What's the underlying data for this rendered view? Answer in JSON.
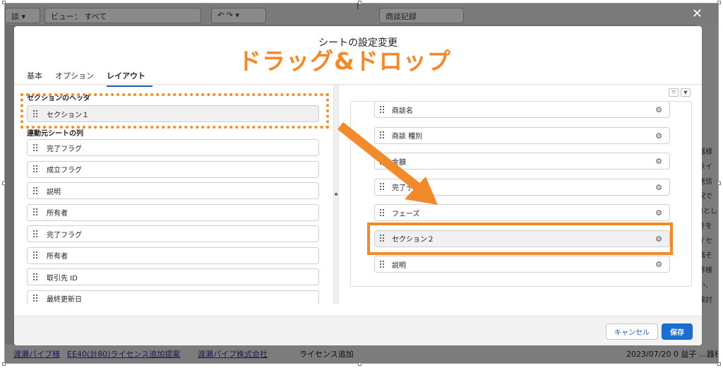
{
  "background": {
    "top_left_label": "談",
    "view_label": "ビュー： すべて",
    "filter_pill": "商談記録",
    "right_column": [
      "器様",
      "ライ",
      "送信",
      "況で",
      "Bとし",
      "きを",
      "イセ",
      "務そ",
      "界様",
      "い、",
      "検討"
    ],
    "bottom_row": {
      "link1": "渡瀬パイプ様",
      "link2": "EE40(計80)ライセンス追加提案",
      "link3": "渡瀬パイプ株式会社",
      "text4": "ライセンス追加",
      "text5": "2023/07/20 0 益子 …器様"
    },
    "close_glyph": "✕"
  },
  "modal": {
    "title": "シートの設定変更",
    "tabs": [
      {
        "label": "基本",
        "active": false
      },
      {
        "label": "オプション",
        "active": false
      },
      {
        "label": "レイアウト",
        "active": true
      }
    ],
    "left": {
      "section_header_label": "セクションのヘッダ",
      "section_header_item": "セクション１",
      "source_columns_label": "連動元シートの列",
      "fields": [
        "完了フラグ",
        "成立フラグ",
        "説明",
        "所有者",
        "完了フラグ",
        "所有者",
        "取引先 ID",
        "最終更新日"
      ]
    },
    "right": {
      "fields": [
        "商談名",
        "商談 種別",
        "金額",
        "完了予定日",
        "フェーズ",
        "セクション２",
        "説明"
      ],
      "highlight_index": 5
    },
    "footer": {
      "cancel_label": "キャンセル",
      "save_label": "保存"
    }
  },
  "annotation": {
    "title": "ドラッグ&ドロップ",
    "color": "#f08a2a"
  },
  "icons": {
    "gear": "gear-icon",
    "grip": "drag-handle-icon",
    "expand": "expand-icon",
    "dropdown": "chevron-down-icon"
  }
}
